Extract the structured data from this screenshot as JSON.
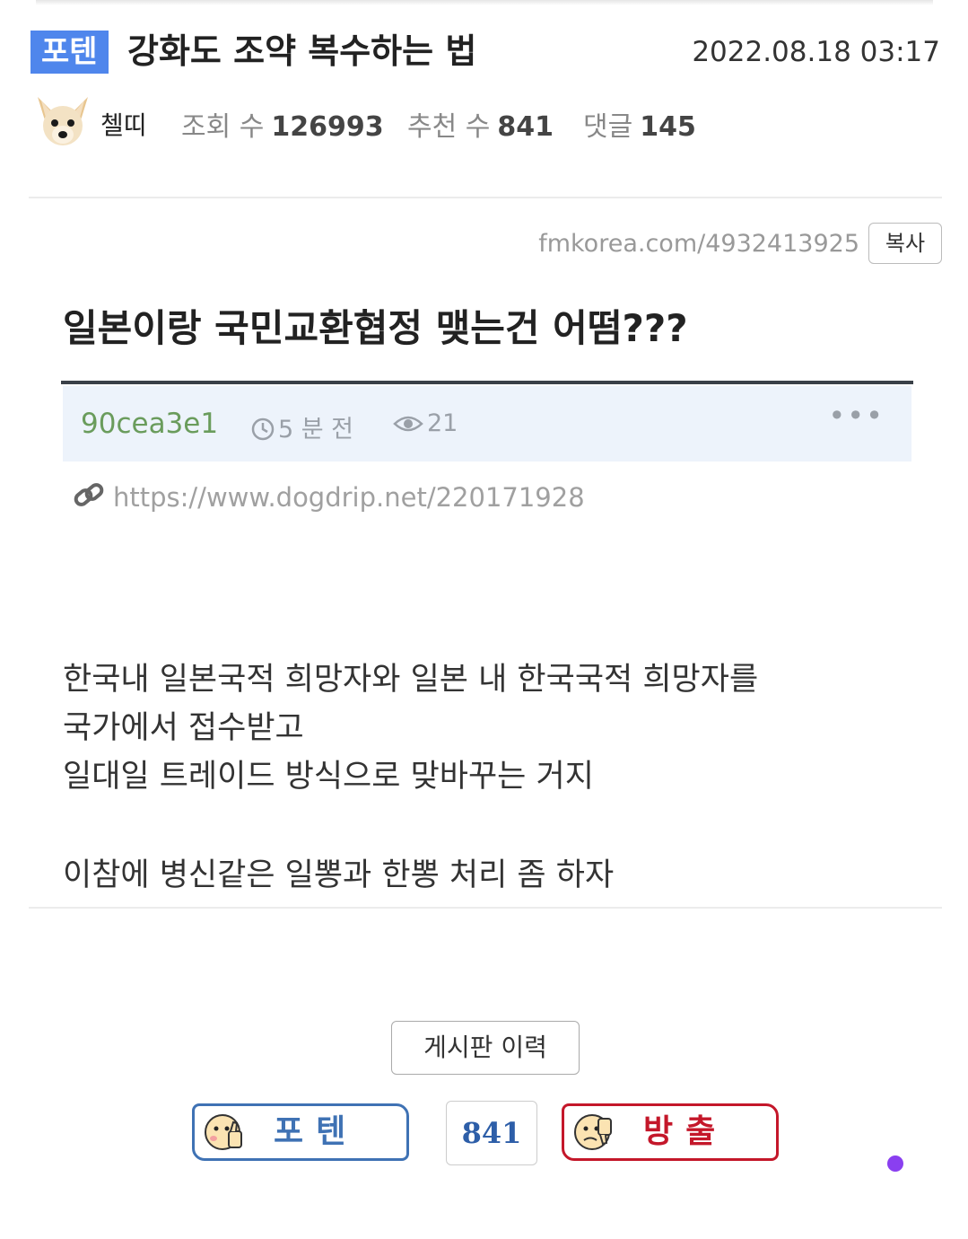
{
  "post": {
    "badge": "포텐",
    "title": "강화도 조약 복수하는 법",
    "date": "2022.08.18 03:17",
    "author": "첼띠",
    "views_label": "조회 수",
    "views": "126993",
    "recommend_label": "추천 수",
    "recommend": "841",
    "comments_label": "댓글",
    "comments": "145"
  },
  "url_bar": {
    "url": "fmkorea.com/4932413925",
    "copy_label": "복사"
  },
  "embed": {
    "title": "일본이랑 국민교환협정 맺는건 어떰???",
    "user": "90cea3e1",
    "time": "5 분 전",
    "views": "21",
    "more": "•••",
    "link": "https://www.dogdrip.net/220171928"
  },
  "body": {
    "lines": [
      "한국내 일본국적 희망자와 일본 내 한국국적 희망자를",
      "국가에서 접수받고",
      "일대일 트레이드 방식으로 맞바꾸는 거지",
      "이참에 병신같은 일뽕과 한뽕 처리 좀 하자"
    ]
  },
  "footer": {
    "history_label": "게시판 이력",
    "vote_up_label": "포텐",
    "vote_count": "841",
    "vote_down_label": "방출"
  },
  "colors": {
    "badge": "#4f86ec",
    "vote_up": "#3f72b4",
    "vote_down": "#c4172a",
    "dot": "#8a3ff0"
  }
}
